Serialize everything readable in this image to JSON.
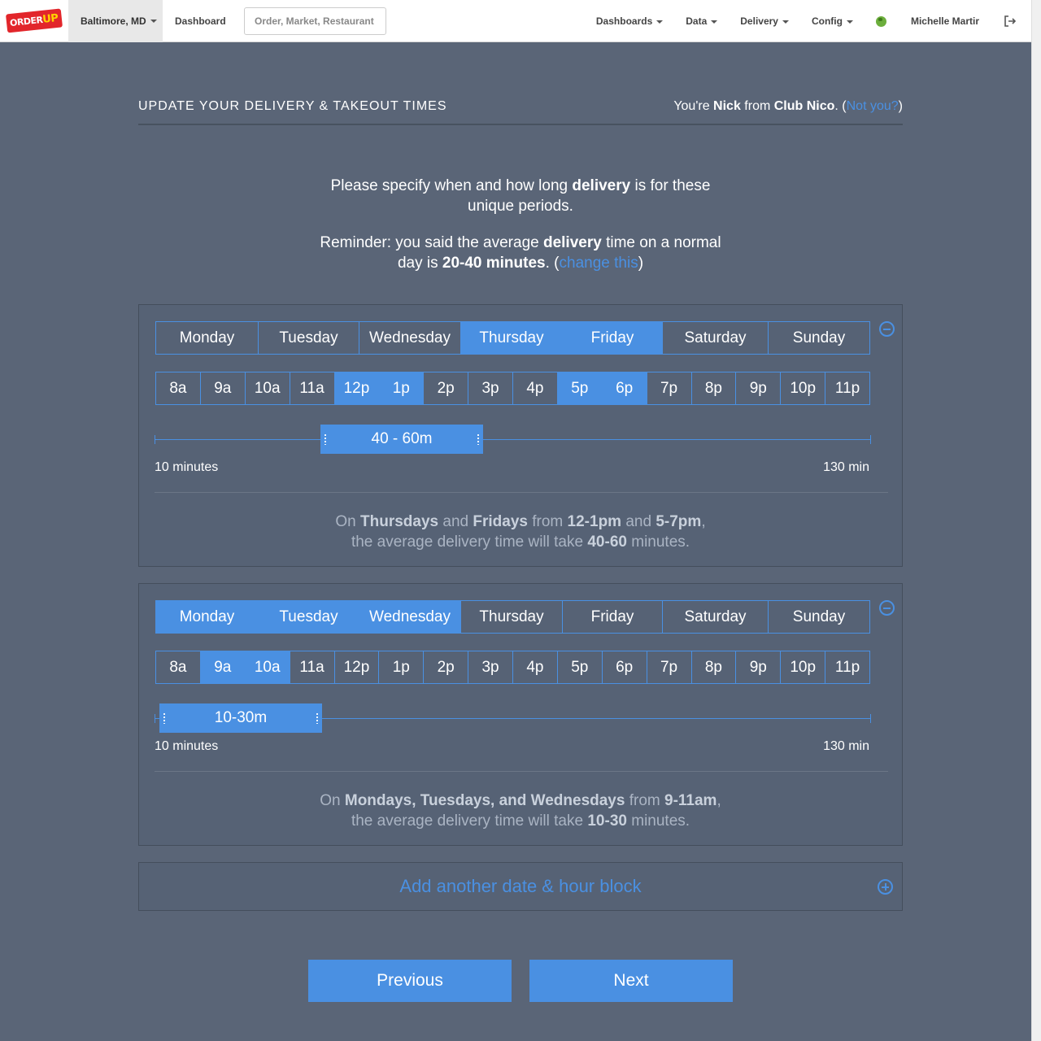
{
  "nav": {
    "logo_text_1": "ORDER",
    "logo_text_2": "UP",
    "city": "Baltimore, MD",
    "dashboard": "Dashboard",
    "search_placeholder": "Order, Market, Restaurant",
    "menus": [
      "Dashboards",
      "Data",
      "Delivery",
      "Config"
    ],
    "user": "Michelle Martir"
  },
  "header": {
    "title": "UPDATE YOUR DELIVERY & TAKEOUT TIMES",
    "who_prefix": "You're ",
    "who_name": "Nick",
    "who_mid": " from ",
    "who_restaurant": "Club Nico",
    "who_punct": ". (",
    "not_you": "Not you?",
    "who_close": ")"
  },
  "intro": {
    "p1_a": "Please specify when and how long ",
    "p1_b": "delivery",
    "p1_c": " is for these unique periods.",
    "p2_a": "Reminder: you said the average ",
    "p2_b": "delivery",
    "p2_c": " time on a normal day is ",
    "p2_d": "20-40 minutes",
    "p2_e": ". (",
    "p2_link": "change this",
    "p2_f": ")"
  },
  "days": [
    "Monday",
    "Tuesday",
    "Wednesday",
    "Thursday",
    "Friday",
    "Saturday",
    "Sunday"
  ],
  "hours": [
    "8a",
    "9a",
    "10a",
    "11a",
    "12p",
    "1p",
    "2p",
    "3p",
    "4p",
    "5p",
    "6p",
    "7p",
    "8p",
    "9p",
    "10p",
    "11p"
  ],
  "range": {
    "min_label": "10 minutes",
    "max_label": "130 min"
  },
  "blocks": [
    {
      "range_label": "40 - 60m",
      "summary": {
        "a": "On ",
        "b": "Thursdays",
        "c": " and ",
        "d": "Fridays",
        "e": " from ",
        "f": "12-1pm",
        "g": " and ",
        "h": "5-7pm",
        "i": ",",
        "j": "the average delivery time will take ",
        "k": "40-60",
        "l": " minutes."
      }
    },
    {
      "range_label": "10-30m",
      "summary": {
        "a": "On ",
        "b": "Mondays, Tuesdays, and Wednesdays",
        "c": " from ",
        "d": "9-11am",
        "e": ",",
        "j": "the average delivery time will take ",
        "k": "10-30",
        "l": " minutes."
      }
    }
  ],
  "add_block": "Add another date & hour block",
  "buttons": {
    "previous": "Previous",
    "next": "Next"
  },
  "colors": {
    "accent": "#4a90e2",
    "background": "#5a6577",
    "panel": "#566275"
  }
}
